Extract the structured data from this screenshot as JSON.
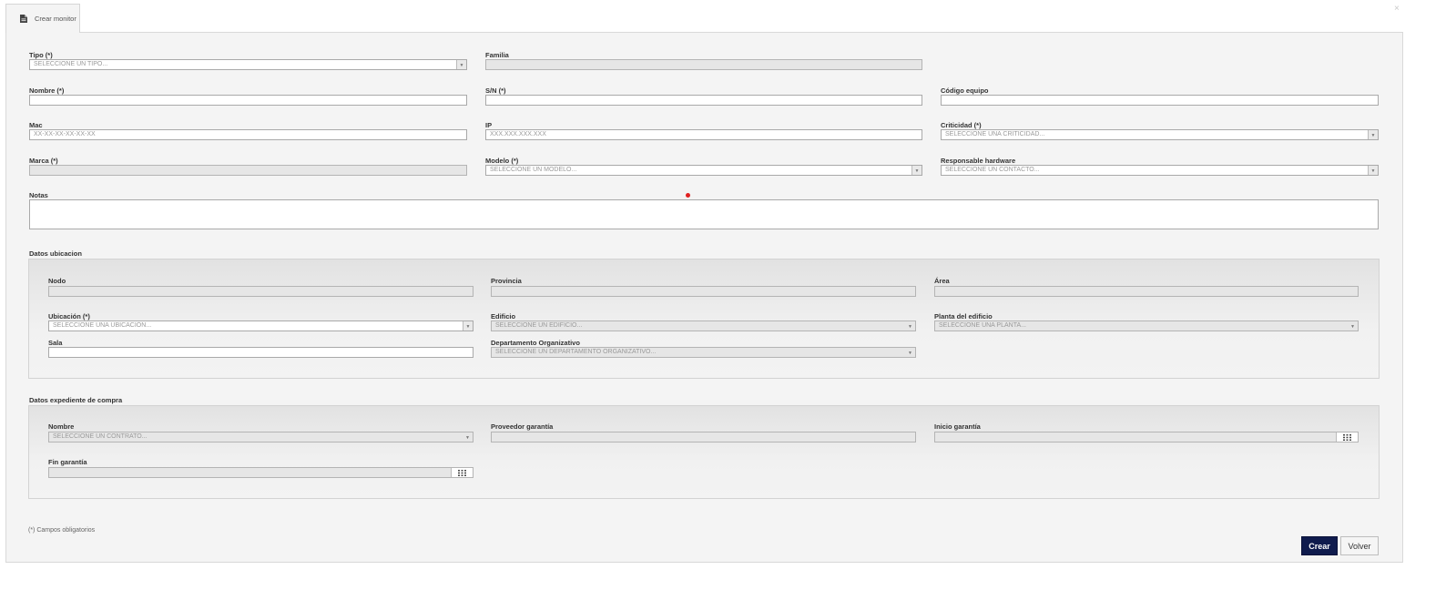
{
  "tab": {
    "icon": "document-icon",
    "label": "Crear monitor"
  },
  "close_icon": "×",
  "form": {
    "tipo": {
      "label": "Tipo (*)",
      "placeholder": "SELECCIONE UN TIPO..."
    },
    "familia": {
      "label": "Familia"
    },
    "nombre": {
      "label": "Nombre (*)"
    },
    "sn": {
      "label": "S/N (*)"
    },
    "codigo_equipo": {
      "label": "Código equipo"
    },
    "mac": {
      "label": "Mac",
      "placeholder": "XX-XX-XX-XX-XX-XX"
    },
    "ip": {
      "label": "IP",
      "placeholder": "XXX.XXX.XXX.XXX"
    },
    "criticidad": {
      "label": "Criticidad (*)",
      "placeholder": "SELECCIONE UNA CRITICIDAD..."
    },
    "marca": {
      "label": "Marca (*)"
    },
    "modelo": {
      "label": "Modelo (*)",
      "placeholder": "SELECCIONE UN MODELO..."
    },
    "responsable": {
      "label": "Responsable hardware",
      "placeholder": "SELECCIONE UN CONTACTO..."
    },
    "notas": {
      "label": "Notas"
    }
  },
  "ubicacion": {
    "title": "Datos ubicacion",
    "nodo": {
      "label": "Nodo"
    },
    "provincia": {
      "label": "Provincia"
    },
    "area": {
      "label": "Área"
    },
    "ubicacion": {
      "label": "Ubicación (*)",
      "placeholder": "SELECCIONE UNA UBICACIÓN..."
    },
    "edificio": {
      "label": "Edificio",
      "placeholder": "SELECCIONE UN EDIFICIO..."
    },
    "planta": {
      "label": "Planta del edificio",
      "placeholder": "SELECCIONE UNA PLANTA..."
    },
    "sala": {
      "label": "Sala"
    },
    "departamento": {
      "label": "Departamento Organizativo",
      "placeholder": "SELECCIONE UN DEPARTAMENTO ORGANIZATIVO..."
    }
  },
  "compra": {
    "title": "Datos expediente de compra",
    "nombre": {
      "label": "Nombre",
      "placeholder": "SELECCIONE UN CONTRATO..."
    },
    "proveedor": {
      "label": "Proveedor garantía"
    },
    "inicio": {
      "label": "Inicio garantía"
    },
    "fin": {
      "label": "Fin garantía"
    }
  },
  "footnote": "(*) Campos obligatorios",
  "buttons": {
    "crear": "Crear",
    "volver": "Volver"
  },
  "colors": {
    "primary_button": "#0f1b4d",
    "panel_bg": "#f4f4f4"
  }
}
